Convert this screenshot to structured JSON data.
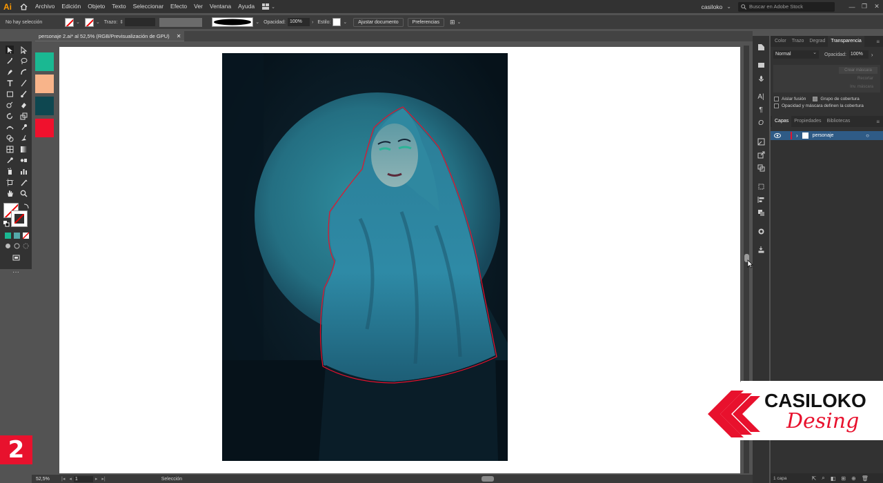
{
  "app": {
    "logo": "Ai",
    "menu": [
      "Archivo",
      "Edición",
      "Objeto",
      "Texto",
      "Seleccionar",
      "Efecto",
      "Ver",
      "Ventana",
      "Ayuda"
    ],
    "user": "casiloko",
    "stock_search_placeholder": "Buscar en Adobe Stock"
  },
  "control_bar": {
    "selection_status": "No hay selección",
    "stroke_label": "Trazo:",
    "opacity_label": "Opacidad:",
    "opacity_value": "100%",
    "style_label": "Estilo:",
    "fit_document": "Ajustar documento",
    "preferences": "Preferencias"
  },
  "document": {
    "tab_title": "personaje 2.ai* al 52,5% (RGB/Previsualización de GPU)",
    "close": "✕"
  },
  "swatches": [
    "#1ab892",
    "#f8b48a",
    "#0e4750",
    "#f0112d"
  ],
  "status_bar": {
    "zoom": "52,5%",
    "page": "1",
    "mode": "Selección"
  },
  "panels": {
    "top_tabs": [
      "Color",
      "Trazo",
      "Degrad",
      "Transparencia"
    ],
    "blend_mode": "Normal",
    "opacity_label": "Opacidad:",
    "opacity_value": "100%",
    "make_mask": "Crear máscara",
    "clip": "Recortar",
    "invert_mask": "Inv. máscara",
    "isolate_blending": "Aislar fusión",
    "knockout_group": "Grupo de cobertura",
    "opacity_mask_knockout": "Opacidad y máscara definen la cobertura",
    "layer_tabs": [
      "Capas",
      "Propiedades",
      "Bibliotecas"
    ],
    "layers": [
      {
        "name": "personaje"
      }
    ],
    "layer_count": "1 capa"
  },
  "overlay": {
    "step_number": "2",
    "brand_line1": "CASILOKO",
    "brand_line2": "Desing"
  },
  "colors": {
    "selection_path": "#e8112d",
    "layer_highlight": "#2f5b86",
    "brand_red": "#e8112d"
  }
}
